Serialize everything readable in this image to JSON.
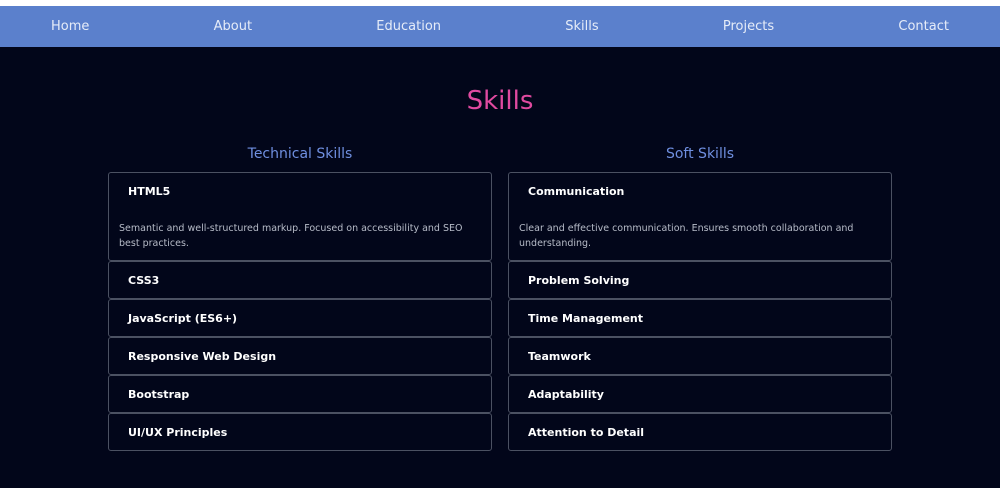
{
  "nav": {
    "items": [
      "Home",
      "About",
      "Education",
      "Skills",
      "Projects",
      "Contact"
    ]
  },
  "page_title": "Skills",
  "technical": {
    "heading": "Technical Skills",
    "items": [
      {
        "title": "HTML5",
        "description": "Semantic and well-structured markup. Focused on accessibility and SEO best practices."
      },
      {
        "title": "CSS3"
      },
      {
        "title": "JavaScript (ES6+)"
      },
      {
        "title": "Responsive Web Design"
      },
      {
        "title": "Bootstrap"
      },
      {
        "title": "UI/UX Principles"
      }
    ]
  },
  "soft": {
    "heading": "Soft Skills",
    "items": [
      {
        "title": "Communication",
        "description": "Clear and effective communication. Ensures smooth collaboration and understanding."
      },
      {
        "title": "Problem Solving"
      },
      {
        "title": "Time Management"
      },
      {
        "title": "Teamwork"
      },
      {
        "title": "Adaptability"
      },
      {
        "title": "Attention to Detail"
      }
    ]
  },
  "colors": {
    "background": "#02061a",
    "navbar": "#5b80cc",
    "title_accent": "#e04aa0",
    "heading_accent": "#6f8fe0"
  }
}
